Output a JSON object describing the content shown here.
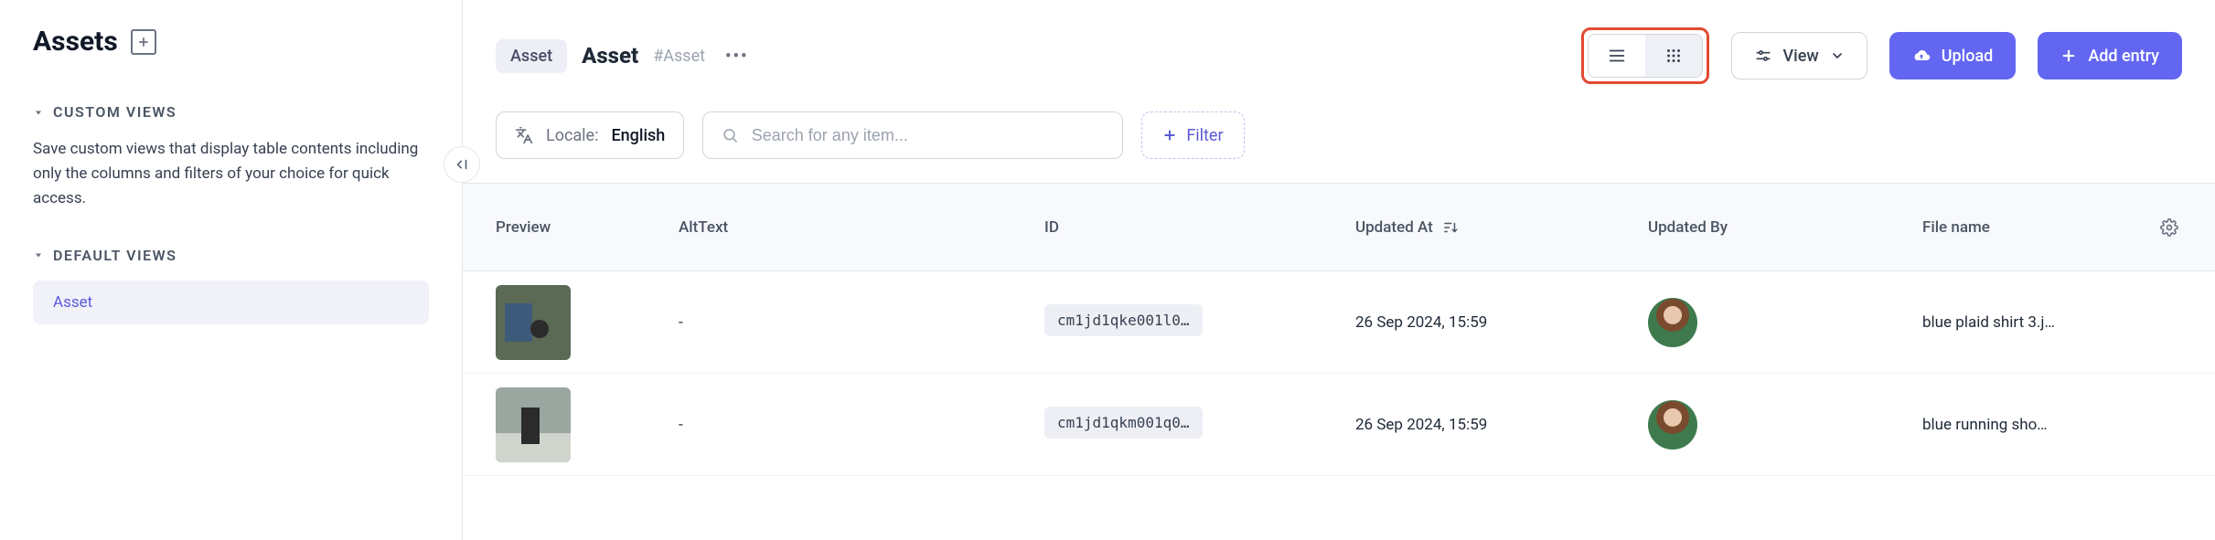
{
  "sidebar": {
    "title": "Assets",
    "custom_views_label": "CUSTOM VIEWS",
    "custom_views_desc": "Save custom views that display table contents including only the columns and filters of your choice for quick access.",
    "default_views_label": "DEFAULT VIEWS",
    "default_view_item": "Asset"
  },
  "header": {
    "crumb_chip": "Asset",
    "crumb_title": "Asset",
    "crumb_id": "#Asset",
    "view_button": "View",
    "upload_button": "Upload",
    "add_entry_button": "Add entry"
  },
  "filterbar": {
    "locale_label": "Locale:",
    "locale_value": "English",
    "search_placeholder": "Search for any item...",
    "filter_label": "Filter"
  },
  "table": {
    "columns": {
      "preview": "Preview",
      "alt_text": "AltText",
      "id": "ID",
      "updated_at": "Updated At",
      "updated_by": "Updated By",
      "file_name": "File name"
    },
    "rows": [
      {
        "alt_text": "-",
        "id": "cm1jd1qke001l0…",
        "updated_at": "26 Sep 2024, 15:59",
        "file_name": "blue plaid shirt 3.j…"
      },
      {
        "alt_text": "-",
        "id": "cm1jd1qkm001q0…",
        "updated_at": "26 Sep 2024, 15:59",
        "file_name": "blue running sho…"
      }
    ]
  }
}
